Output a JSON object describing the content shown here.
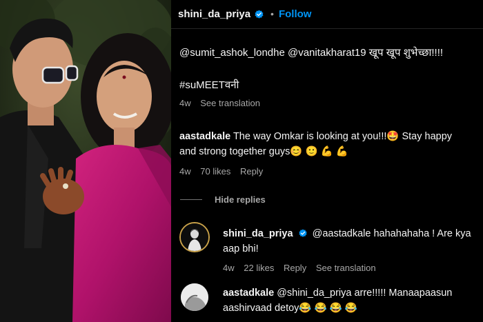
{
  "header": {
    "username": "shini_da_priya",
    "dot": "•",
    "follow_label": "Follow"
  },
  "post": {
    "caption": "@sumit_ashok_londhe @vanitakharat19 खूप खूप शुभेच्छा!!!!",
    "hashtag": "#suMEETवनी",
    "age": "4w",
    "see_translation": "See translation"
  },
  "comments": [
    {
      "username": "aastadkale",
      "line1": "The way Omkar is looking at you!!!🤩  Stay happy",
      "line2": "and strong together guys😊 🙂 💪 💪",
      "age": "4w",
      "likes": "70 likes",
      "reply_label": "Reply"
    }
  ],
  "hide_replies": "Hide replies",
  "replies": [
    {
      "username": "shini_da_priya",
      "line1": "@aastadkale hahahahaha ! Are kya",
      "line2": "aap bhi!",
      "age": "4w",
      "likes": "22 likes",
      "reply_label": "Reply",
      "see_translation": "See translation"
    },
    {
      "username": "aastadkale",
      "line1": "@shini_da_priya arre!!!!! Manaapaasun",
      "line2": "aashirvaad detoy😂 😂 😂 😂"
    }
  ],
  "colors": {
    "accent": "#0095f6",
    "background": "#000000",
    "secondary_text": "#a8a8a8"
  },
  "icons": [
    "verified-badge-icon"
  ]
}
